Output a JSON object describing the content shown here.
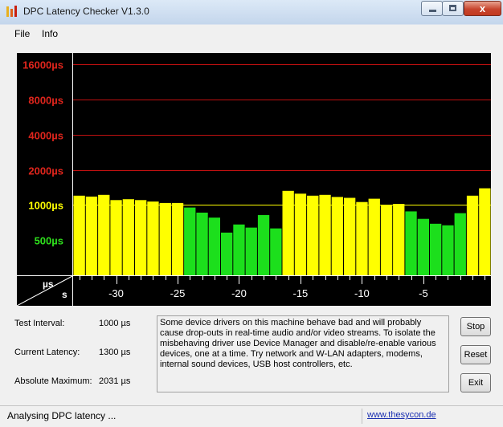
{
  "window": {
    "title": "DPC Latency Checker V1.3.0",
    "close_glyph": "x"
  },
  "menu": {
    "file": "File",
    "info": "Info"
  },
  "chart_data": {
    "type": "bar",
    "y_axis_labels": [
      {
        "text": "16000µs",
        "value": 16000,
        "color": "#e0251c"
      },
      {
        "text": "8000µs",
        "value": 8000,
        "color": "#e0251c"
      },
      {
        "text": "4000µs",
        "value": 4000,
        "color": "#e0251c"
      },
      {
        "text": "2000µs",
        "value": 2000,
        "color": "#e0251c"
      },
      {
        "text": "1000µs",
        "value": 1000,
        "color": "#ffff00"
      },
      {
        "text": "500µs",
        "value": 500,
        "color": "#2ee01c"
      }
    ],
    "scale": "log2",
    "ylim": [
      250,
      20000
    ],
    "corner_top_label": "µs",
    "corner_bottom_label": "s",
    "xlim": [
      -33.5,
      0.5
    ],
    "x_tick_labels": [
      "-30",
      "-25",
      "-20",
      "-15",
      "-10",
      "-5"
    ],
    "x_tick_values": [
      -30,
      -25,
      -20,
      -15,
      -10,
      -5
    ],
    "x": [
      -33,
      -32,
      -31,
      -30,
      -29,
      -28,
      -27,
      -26,
      -25,
      -24,
      -23,
      -22,
      -21,
      -20,
      -19,
      -18,
      -17,
      -16,
      -15,
      -14,
      -13,
      -12,
      -11,
      -10,
      -9,
      -8,
      -7,
      -6,
      -5,
      -4,
      -3,
      -2,
      -1,
      0
    ],
    "values": [
      1200,
      1180,
      1220,
      1100,
      1120,
      1100,
      1070,
      1040,
      1040,
      950,
      860,
      780,
      580,
      680,
      640,
      820,
      630,
      1320,
      1250,
      1200,
      1220,
      1170,
      1150,
      1060,
      1130,
      1000,
      1020,
      880,
      760,
      690,
      670,
      850,
      1200,
      1390
    ],
    "colors": {
      "ok": "#ffff00",
      "good": "#1cdf1c",
      "background": "#000000",
      "gridline": "#c01010",
      "threshold_line": "#ffff00"
    }
  },
  "stats": {
    "test_interval_label": "Test Interval:",
    "test_interval_value": "1000 µs",
    "current_latency_label": "Current Latency:",
    "current_latency_value": "1300 µs",
    "absolute_maximum_label": "Absolute Maximum:",
    "absolute_maximum_value": "2031 µs"
  },
  "message": "Some device drivers on this machine behave bad and will probably cause drop-outs in real-time audio and/or video streams. To isolate the misbehaving driver use Device Manager and disable/re-enable various devices, one at a time. Try network and W-LAN adapters, modems, internal sound devices, USB host controllers, etc.",
  "buttons": {
    "stop": "Stop",
    "reset": "Reset",
    "exit": "Exit"
  },
  "status": {
    "text": "Analysing DPC latency ...",
    "link": "www.thesycon.de"
  }
}
